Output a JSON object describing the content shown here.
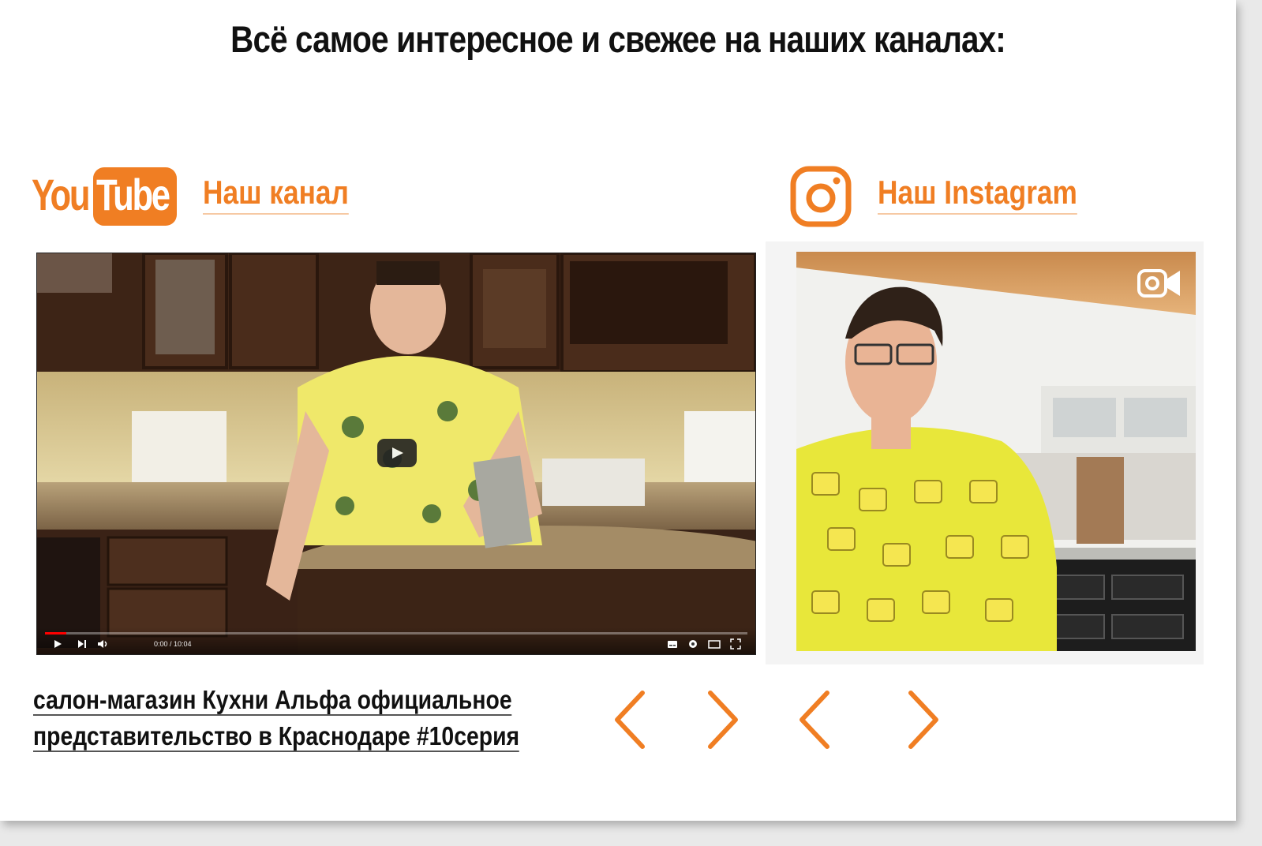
{
  "heading": "Всё самое интересное и свежее на наших каналах:",
  "youtube": {
    "logo_you": "You",
    "logo_tube": "Tube",
    "link_label": "Наш канал",
    "video": {
      "time": "0:00 / 10:04",
      "progress_fraction": 0.03
    },
    "caption": "салон-магазин Кухни Альфа официальное представительство в Краснодаре #10серия",
    "prev_icon": "chevron-left-icon",
    "next_icon": "chevron-right-icon"
  },
  "instagram": {
    "link_label": "Наш Instagram",
    "icon": "instagram-icon",
    "video_badge_icon": "video-camera-icon",
    "prev_icon": "chevron-left-icon",
    "next_icon": "chevron-right-icon"
  },
  "colors": {
    "accent": "#f07e23",
    "text": "#111111",
    "background": "#ffffff"
  }
}
